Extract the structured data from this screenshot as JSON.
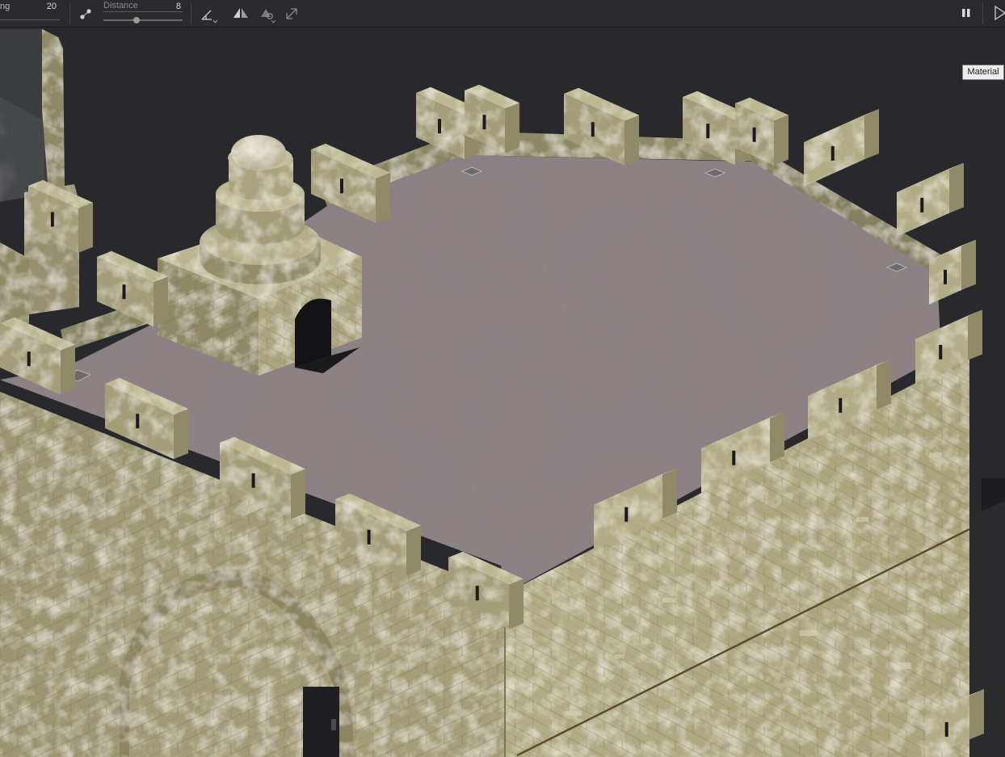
{
  "toolbar": {
    "spacing_label_fragment": "ng",
    "spacing_value": "20",
    "distance_label": "Distance",
    "distance_value": "8",
    "distance_slider_fraction": 0.42,
    "icons": [
      "snap-points-icon",
      "angle-snap-icon",
      "mirror-icon",
      "pivot-rotate-icon",
      "transform-icon",
      "pause-icon",
      "play-icon"
    ]
  },
  "viewport": {
    "tooltip_text": "Material",
    "background_color": "#29292d",
    "stone_color": "#a8a47a",
    "roof_color": "#8c8284"
  }
}
